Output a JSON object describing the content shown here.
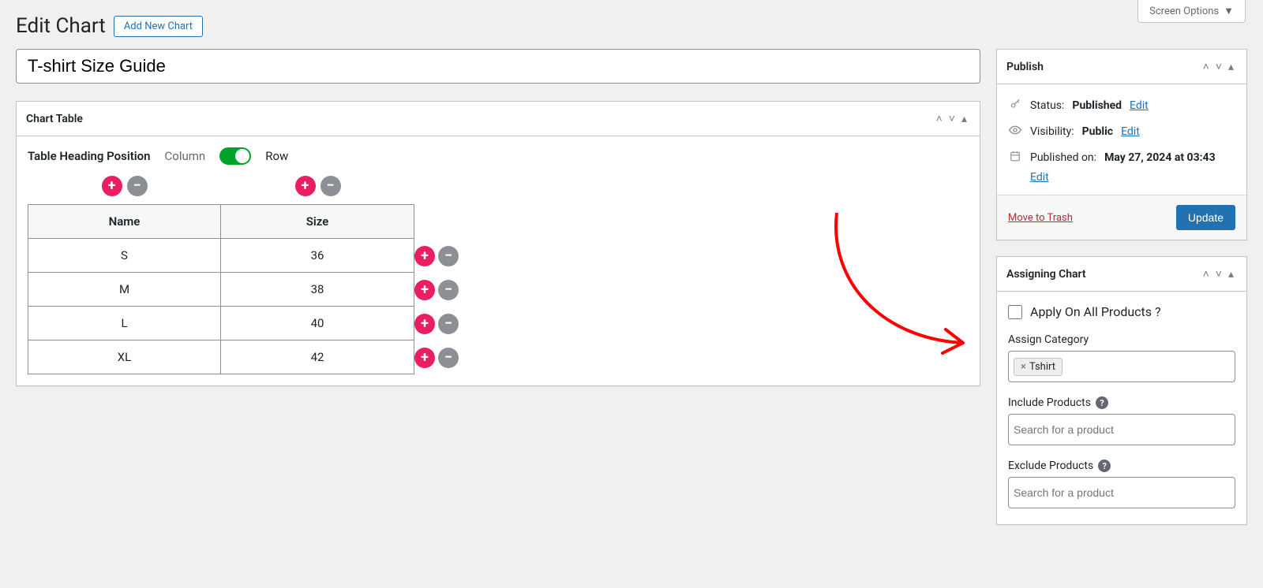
{
  "screen_options_label": "Screen Options",
  "page_title": "Edit Chart",
  "add_new_label": "Add New Chart",
  "doc_title": "T-shirt Size Guide",
  "chart_table": {
    "panel_title": "Chart Table",
    "heading_position_label": "Table Heading Position",
    "option_left": "Column",
    "option_right": "Row",
    "headers": [
      "Name",
      "Size"
    ],
    "rows": [
      {
        "name": "S",
        "size": "36"
      },
      {
        "name": "M",
        "size": "38"
      },
      {
        "name": "L",
        "size": "40"
      },
      {
        "name": "XL",
        "size": "42"
      }
    ]
  },
  "chart_data": {
    "type": "table",
    "title": "T-shirt Size Guide",
    "columns": [
      "Name",
      "Size"
    ],
    "rows": [
      [
        "S",
        36
      ],
      [
        "M",
        38
      ],
      [
        "L",
        40
      ],
      [
        "XL",
        42
      ]
    ]
  },
  "publish": {
    "panel_title": "Publish",
    "status_label": "Status:",
    "status_value": "Published",
    "visibility_label": "Visibility:",
    "visibility_value": "Public",
    "published_label": "Published on:",
    "published_value": "May 27, 2024 at 03:43",
    "edit_link": "Edit",
    "trash_label": "Move to Trash",
    "update_label": "Update"
  },
  "assign": {
    "panel_title": "Assigning Chart",
    "apply_all_label": "Apply On All Products ?",
    "assign_category_label": "Assign Category",
    "category_tag": "Tshirt",
    "include_label": "Include Products",
    "exclude_label": "Exclude Products",
    "search_placeholder": "Search for a product"
  }
}
